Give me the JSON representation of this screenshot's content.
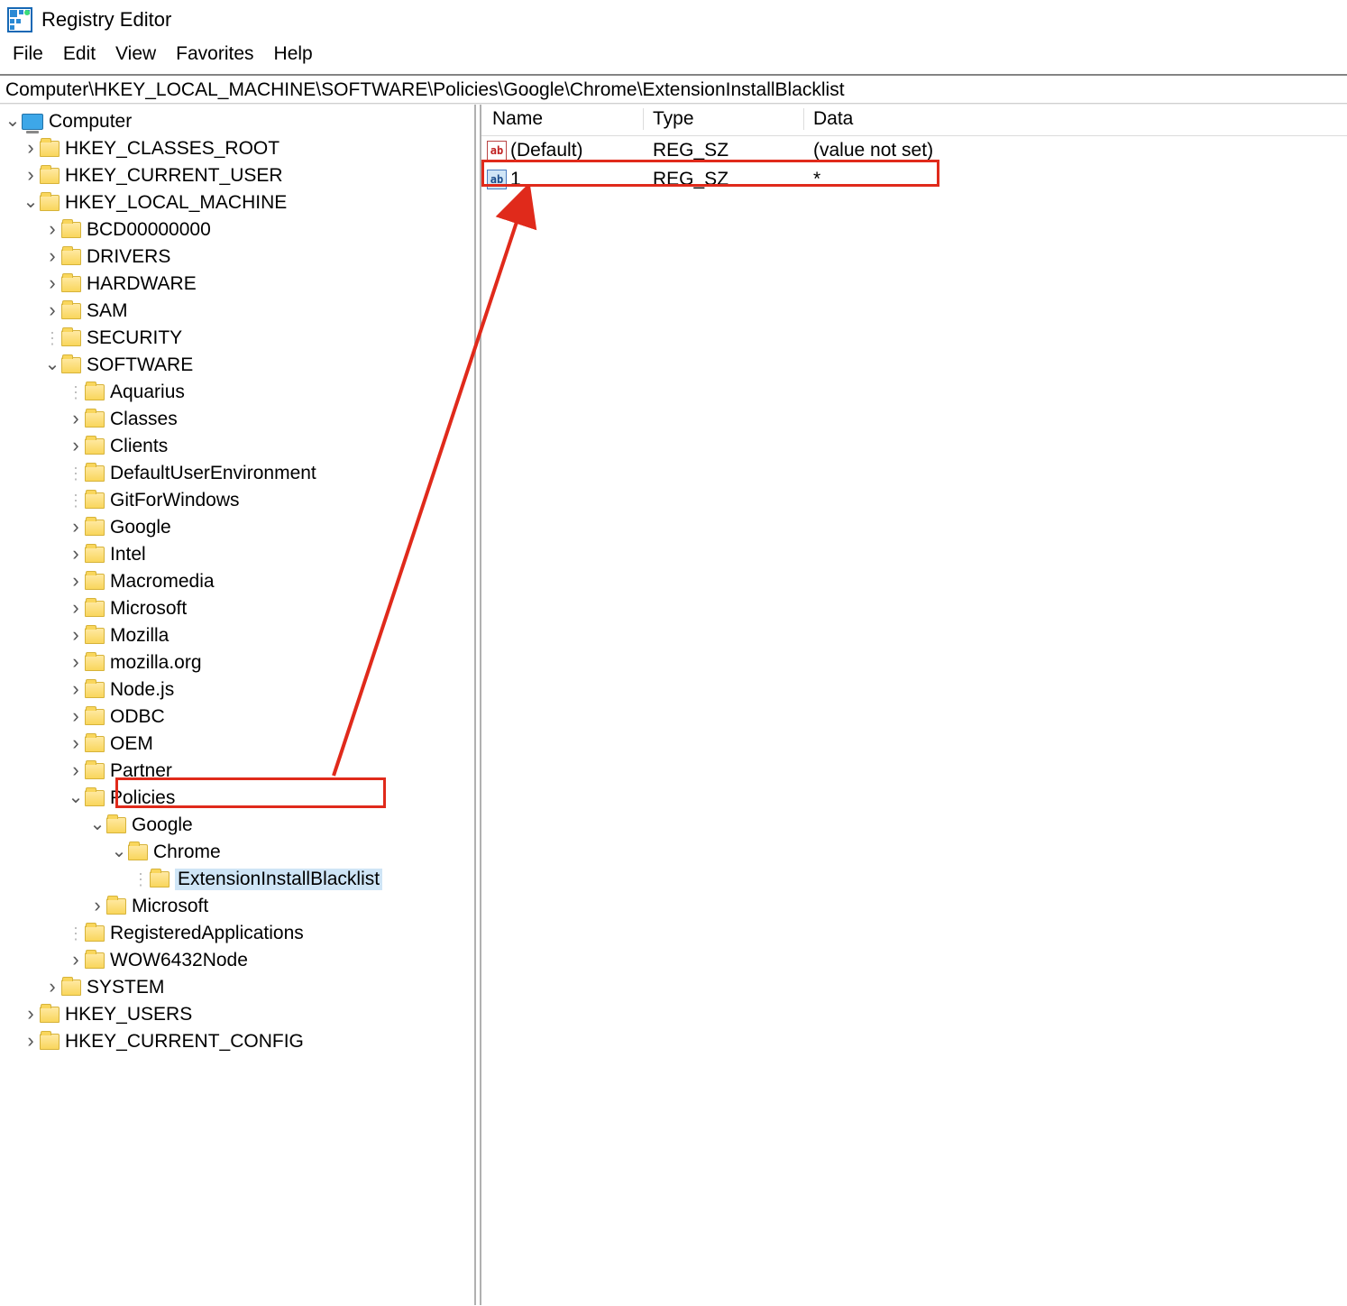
{
  "window": {
    "title": "Registry Editor"
  },
  "menu": {
    "file": "File",
    "edit": "Edit",
    "view": "View",
    "favorites": "Favorites",
    "help": "Help"
  },
  "addressbar": "Computer\\HKEY_LOCAL_MACHINE\\SOFTWARE\\Policies\\Google\\Chrome\\ExtensionInstallBlacklist",
  "list": {
    "headers": {
      "name": "Name",
      "type": "Type",
      "data": "Data"
    },
    "rows": [
      {
        "name": "(Default)",
        "type": "REG_SZ",
        "data": "(value not set)",
        "selected": false
      },
      {
        "name": "1",
        "type": "REG_SZ",
        "data": "*",
        "selected": true
      }
    ]
  },
  "tree": {
    "root": "Computer",
    "hives": {
      "hkcr": "HKEY_CLASSES_ROOT",
      "hkcu": "HKEY_CURRENT_USER",
      "hklm": "HKEY_LOCAL_MACHINE",
      "hku": "HKEY_USERS",
      "hkcc": "HKEY_CURRENT_CONFIG"
    },
    "hklm_children": {
      "bcd": "BCD00000000",
      "drivers": "DRIVERS",
      "hardware": "HARDWARE",
      "sam": "SAM",
      "security": "SECURITY",
      "software": "SOFTWARE",
      "system": "SYSTEM"
    },
    "software_children": [
      "Aquarius",
      "Classes",
      "Clients",
      "DefaultUserEnvironment",
      "GitForWindows",
      "Google",
      "Intel",
      "Macromedia",
      "Microsoft",
      "Mozilla",
      "mozilla.org",
      "Node.js",
      "ODBC",
      "OEM",
      "Partner",
      "Policies",
      "RegisteredApplications",
      "WOW6432Node"
    ],
    "policies_children": {
      "google": "Google",
      "microsoft": "Microsoft"
    },
    "google_child": "Chrome",
    "chrome_child": "ExtensionInstallBlacklist"
  }
}
